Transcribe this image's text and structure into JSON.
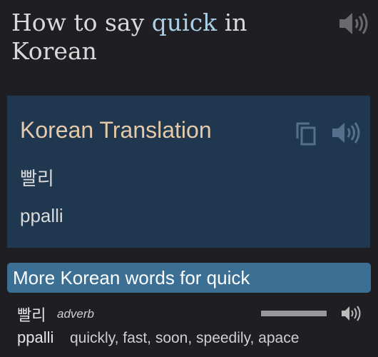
{
  "header": {
    "title_prefix": "How to say",
    "word": "quick",
    "title_mid": "in",
    "language": "Korean",
    "speaker_icon": "speaker-icon"
  },
  "translation_card": {
    "title": "Korean Translation",
    "native": "빨리",
    "romanization": "ppalli",
    "copy_icon": "copy-icon",
    "speaker_icon": "speaker-icon"
  },
  "more_words": {
    "heading": "More Korean words for quick",
    "entries": [
      {
        "native": "빨리",
        "part_of_speech": "adverb",
        "romanization": "ppalli",
        "meanings": "quickly, fast, soon, speedily, apace",
        "frequency_fraction": 1.0,
        "speaker_icon": "speaker-icon"
      }
    ]
  },
  "colors": {
    "background": "#1f1f23",
    "highlight_word": "#a9cfe6",
    "card_background": "#203750",
    "card_title": "#e6c9a8",
    "banner_background": "#3b6f94"
  }
}
